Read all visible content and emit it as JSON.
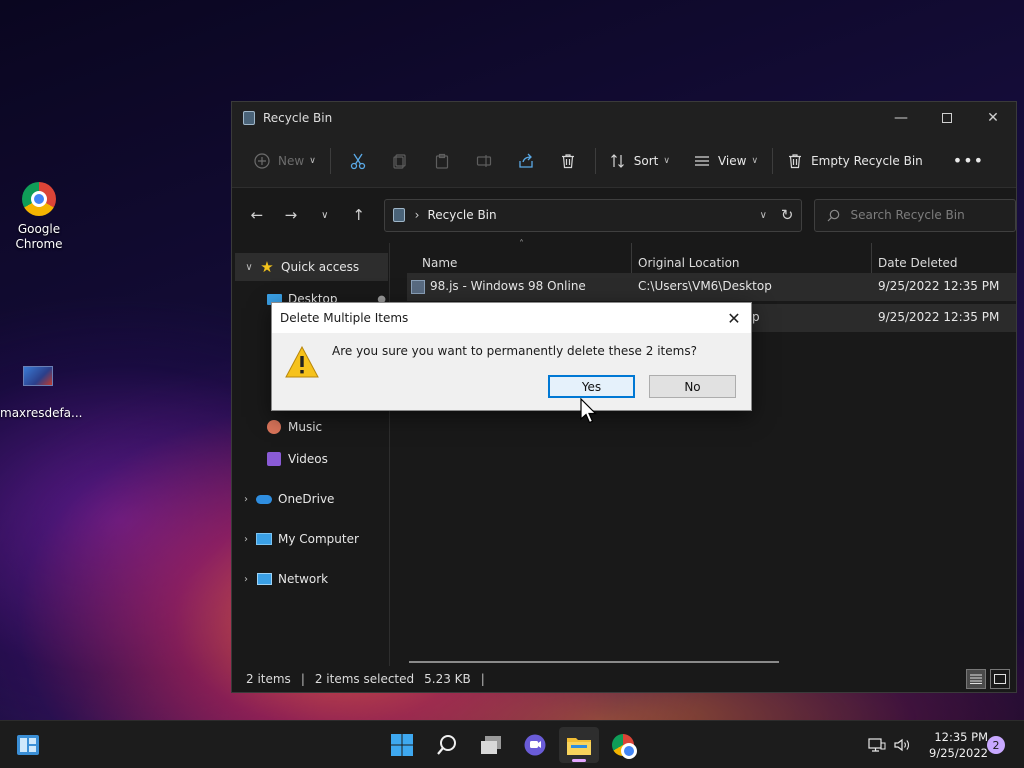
{
  "desktop": {
    "icons": [
      {
        "label_line1": "Google",
        "label_line2": "Chrome"
      },
      {
        "label_line1": "maxresdefa..."
      }
    ]
  },
  "window": {
    "title": "Recycle Bin",
    "toolbar": {
      "new_label": "New",
      "sort_label": "Sort",
      "view_label": "View",
      "empty_label": "Empty Recycle Bin"
    },
    "address": {
      "crumb": "Recycle Bin",
      "search_placeholder": "Search Recycle Bin"
    },
    "nav_pane": {
      "quick_access": "Quick access",
      "desktop": "Desktop",
      "music": "Music",
      "videos": "Videos",
      "onedrive": "OneDrive",
      "my_computer": "My Computer",
      "network": "Network"
    },
    "columns": {
      "name": "Name",
      "original_location": "Original Location",
      "date_deleted": "Date Deleted"
    },
    "rows": [
      {
        "name": "98.js - Windows 98 Online",
        "location": "C:\\Users\\VM6\\Desktop",
        "date": "9/25/2022 12:35 PM"
      },
      {
        "name": "",
        "location": "p",
        "date": "9/25/2022 12:35 PM"
      }
    ],
    "status": {
      "count": "2 items",
      "selected": "2 items selected",
      "size": "5.23 KB"
    }
  },
  "dialog": {
    "title": "Delete Multiple Items",
    "message": "Are you sure you want to permanently delete these 2 items?",
    "yes_label": "Yes",
    "no_label": "No"
  },
  "taskbar": {
    "time": "12:35 PM",
    "date": "9/25/2022",
    "notification_count": "2"
  },
  "colors": {
    "accent": "#0078d4",
    "window_bg": "#191919",
    "dialog_bg": "#f0f0f0"
  }
}
